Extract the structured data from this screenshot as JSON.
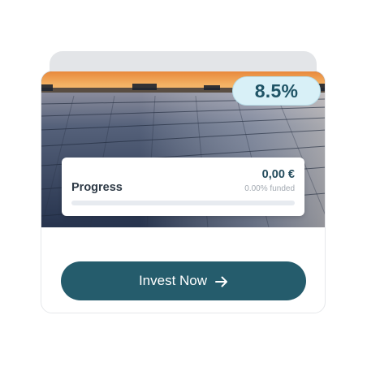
{
  "offer": {
    "rate": "8.5%",
    "image_subject": "solar panel field at sunset"
  },
  "progress": {
    "label": "Progress",
    "amount": "0,00 €",
    "funded_text": "0.00% funded",
    "funded_fraction": 0.0
  },
  "actions": {
    "invest_label": "Invest Now",
    "invest_icon": "arrow-right-icon"
  },
  "colors": {
    "button": "#255c6c",
    "badge_bg": "#d8f0f7",
    "badge_text": "#1f5466",
    "amount_text": "#254d5e"
  }
}
